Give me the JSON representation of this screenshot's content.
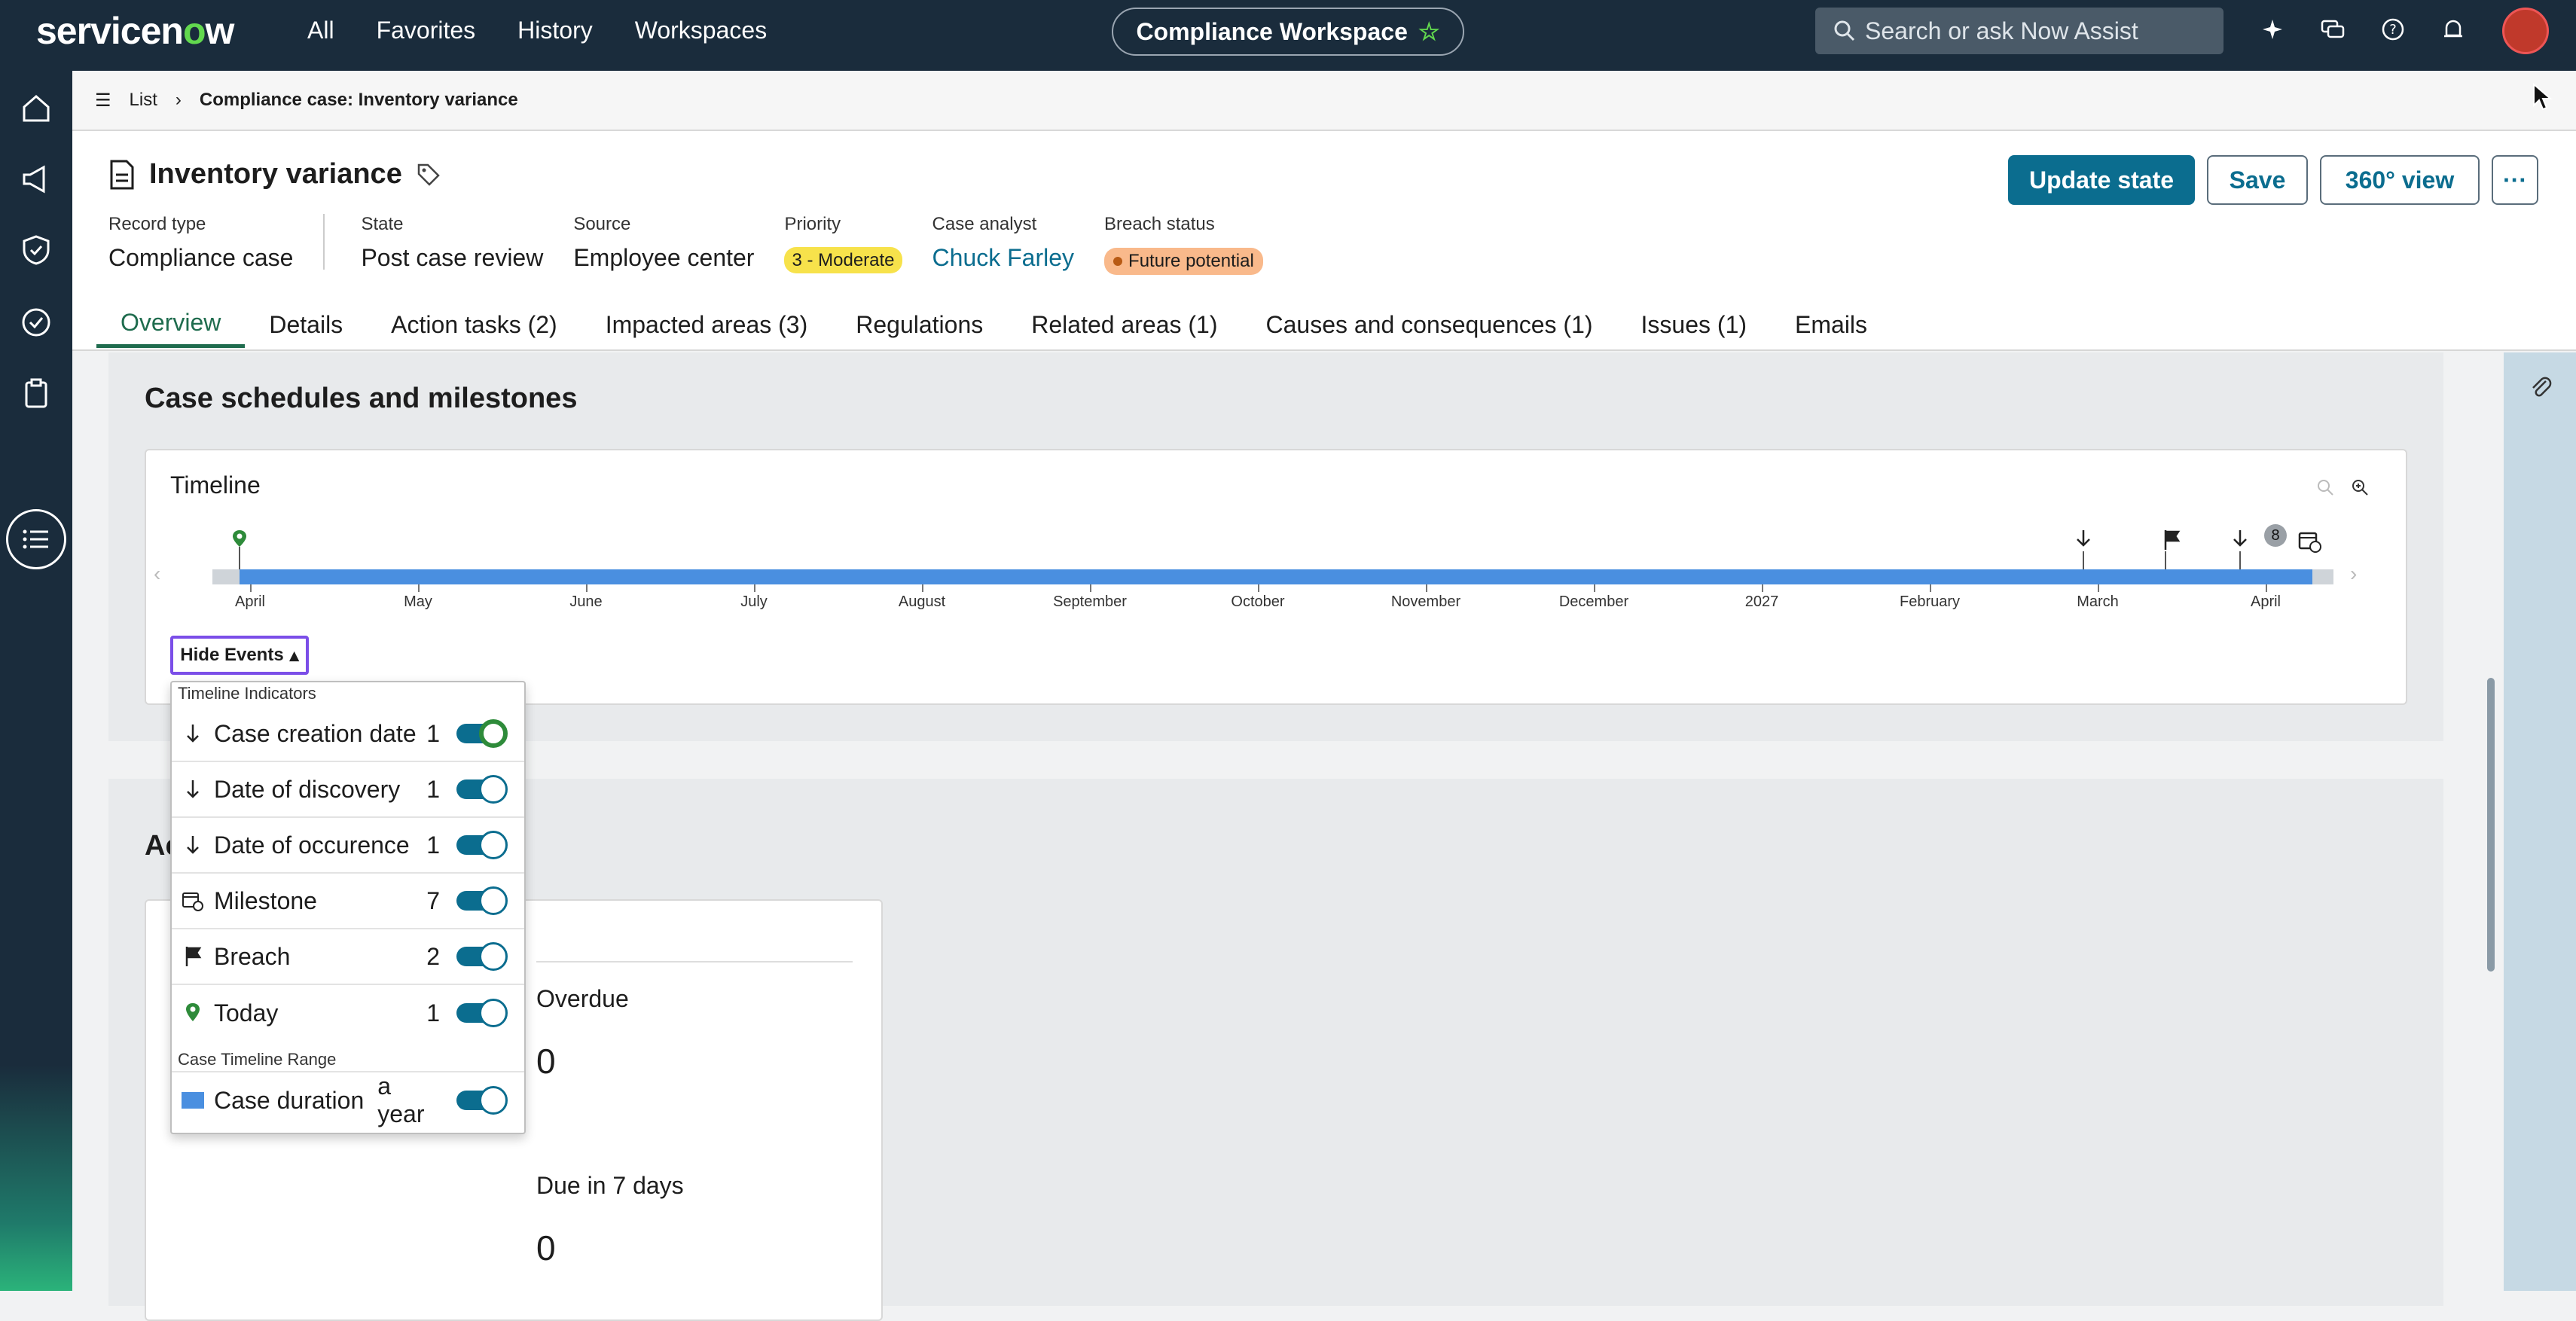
{
  "topbar": {
    "logo": "servicenow",
    "nav": [
      "All",
      "Favorites",
      "History",
      "Workspaces"
    ],
    "workspace": "Compliance Workspace",
    "search_placeholder": "Search or ask Now Assist"
  },
  "breadcrumb": {
    "list": "List",
    "current": "Compliance case: Inventory variance"
  },
  "record": {
    "title": "Inventory variance",
    "buttons": {
      "update": "Update state",
      "save": "Save",
      "view": "360° view",
      "more": "···"
    },
    "fields": {
      "record_type_label": "Record type",
      "record_type": "Compliance case",
      "state_label": "State",
      "state": "Post case review",
      "source_label": "Source",
      "source": "Employee center",
      "priority_label": "Priority",
      "priority": "3 - Moderate",
      "analyst_label": "Case analyst",
      "analyst": "Chuck Farley",
      "breach_label": "Breach status",
      "breach": "Future potential"
    }
  },
  "tabs": [
    "Overview",
    "Details",
    "Action tasks (2)",
    "Impacted areas (3)",
    "Regulations",
    "Related areas (1)",
    "Causes and consequences (1)",
    "Issues (1)",
    "Emails"
  ],
  "schedule": {
    "title": "Case schedules and milestones",
    "timeline_title": "Timeline",
    "months": [
      "April",
      "May",
      "June",
      "July",
      "August",
      "September",
      "October",
      "November",
      "December",
      "2027",
      "February",
      "March",
      "April"
    ],
    "cluster_count": "8",
    "hide_events": "Hide Events"
  },
  "events_panel": {
    "indicators_header": "Timeline Indicators",
    "range_header": "Case Timeline Range",
    "rows": [
      {
        "label": "Case creation date",
        "count": "1"
      },
      {
        "label": "Date of discovery",
        "count": "1"
      },
      {
        "label": "Date of occurence",
        "count": "1"
      },
      {
        "label": "Milestone",
        "count": "7"
      },
      {
        "label": "Breach",
        "count": "2"
      },
      {
        "label": "Today",
        "count": "1"
      }
    ],
    "duration": {
      "label": "Case duration",
      "value": "a year"
    }
  },
  "section2": {
    "title_partial": "Ac",
    "overdue_label": "Overdue",
    "overdue_value": "0",
    "due7_label": "Due in 7 days",
    "due7_value": "0"
  }
}
